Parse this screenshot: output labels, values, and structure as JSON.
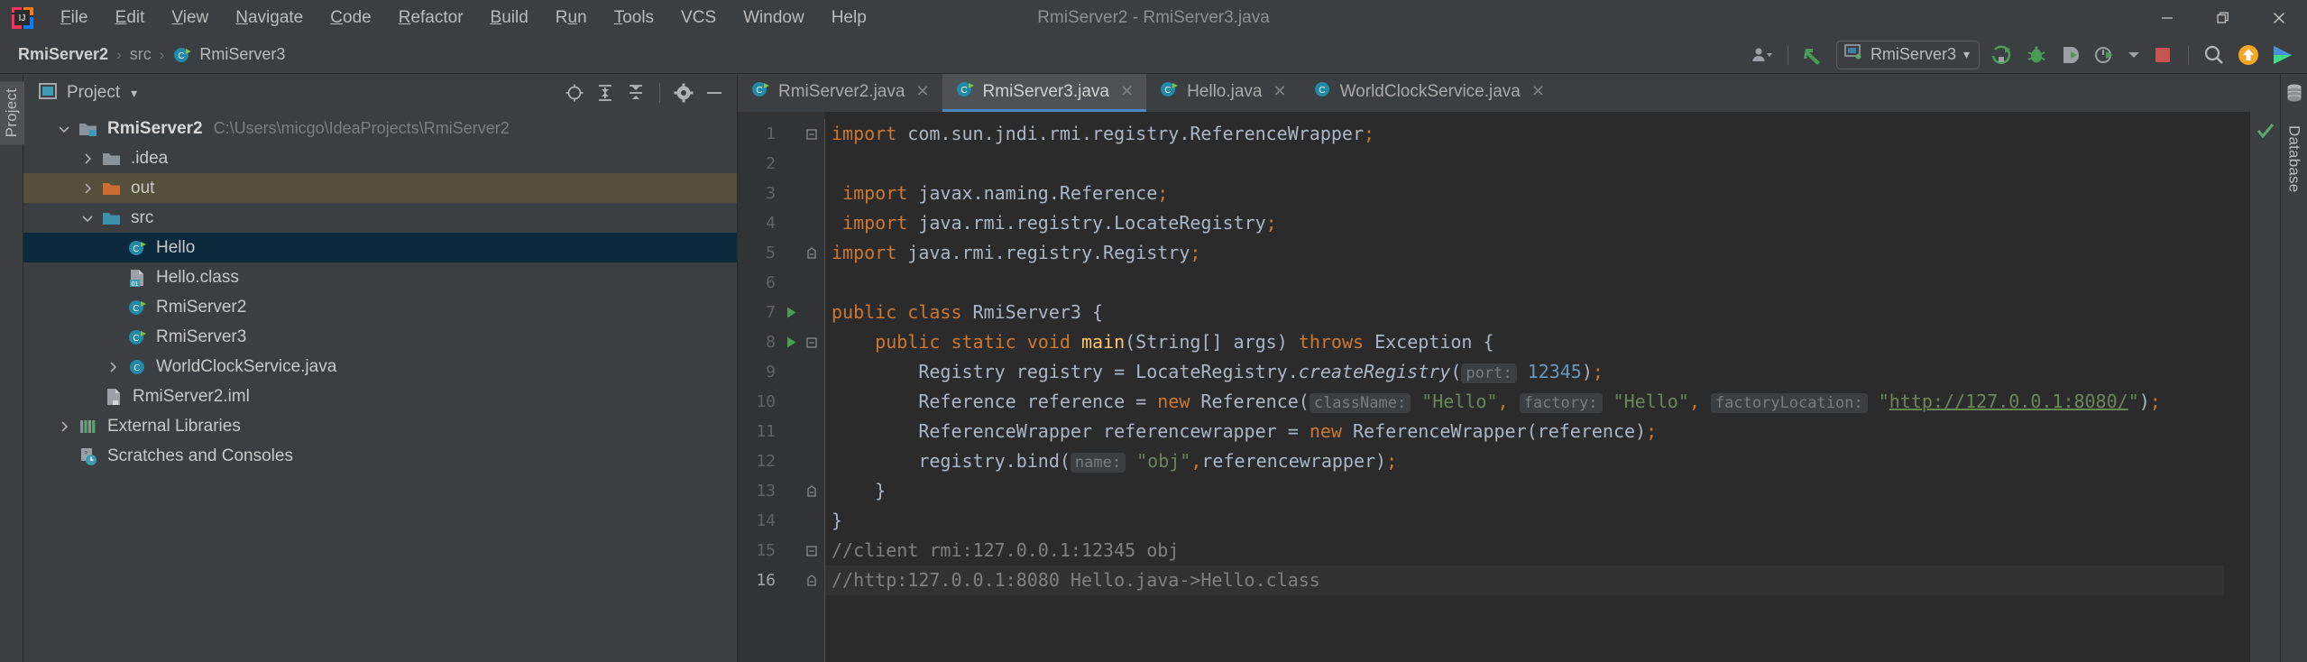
{
  "window": {
    "title": "RmiServer2 - RmiServer3.java",
    "app_icon": "intellij-idea-logo",
    "controls": {
      "minimize": "–",
      "maximize": "restore-icon",
      "close": "✕"
    }
  },
  "menubar": {
    "items": [
      {
        "label": "File",
        "mnemonic": "F"
      },
      {
        "label": "Edit",
        "mnemonic": "E"
      },
      {
        "label": "View",
        "mnemonic": "V"
      },
      {
        "label": "Navigate",
        "mnemonic": "N"
      },
      {
        "label": "Code",
        "mnemonic": "C"
      },
      {
        "label": "Refactor",
        "mnemonic": "R"
      },
      {
        "label": "Build",
        "mnemonic": "B"
      },
      {
        "label": "Run",
        "mnemonic": "u"
      },
      {
        "label": "Tools",
        "mnemonic": "T"
      },
      {
        "label": "VCS",
        "mnemonic": ""
      },
      {
        "label": "Window",
        "mnemonic": ""
      },
      {
        "label": "Help",
        "mnemonic": ""
      }
    ]
  },
  "navbar": {
    "breadcrumbs": [
      {
        "label": "RmiServer2",
        "icon": "",
        "bold": true
      },
      {
        "label": "src",
        "icon": "",
        "bold": false
      },
      {
        "label": "RmiServer3",
        "icon": "java-class-icon",
        "bold": false
      }
    ],
    "separator": "›",
    "toolbar": {
      "user_icon": "user-silhouette-icon",
      "user_caret": "▾",
      "vcs_update_icon": "vcs-update-arrow-icon",
      "run_config_icon": "application-config-icon",
      "run_config_label": "RmiServer3",
      "run_config_caret": "▾",
      "run_icon": "run-icon",
      "debug_icon": "debug-bug-icon",
      "run_coverage_icon": "run-with-coverage-icon",
      "profiler_icon": "profiler-icon",
      "profiler_caret": "▾",
      "stop_icon": "stop-square-icon",
      "search_icon": "search-everywhere-icon",
      "update_icon": "update-available-icon",
      "ide_icon": "ide-features-icon"
    }
  },
  "left_stripe": {
    "tabs": [
      {
        "label": "Project",
        "active": true
      }
    ]
  },
  "right_stripe": {
    "tabs": [
      {
        "label": "Database",
        "icon": "database-icon",
        "active": false
      }
    ]
  },
  "project_panel": {
    "icon": "project-view-icon",
    "title": "Project",
    "caret": "▾",
    "actions": [
      {
        "name": "select-opened-file-icon",
        "glyph": "target"
      },
      {
        "name": "expand-all-icon",
        "glyph": "expand"
      },
      {
        "name": "collapse-all-icon",
        "glyph": "collapse"
      },
      {
        "name": "settings-gear-icon",
        "glyph": "gear"
      },
      {
        "name": "hide-panel-icon",
        "glyph": "minus"
      }
    ],
    "tree": [
      {
        "label": "RmiServer2",
        "path": "C:\\Users\\micgo\\IdeaProjects\\RmiServer2",
        "indent": 0,
        "twisty": "down",
        "icon": "project-folder-icon",
        "bold": true,
        "state": "none"
      },
      {
        "label": ".idea",
        "path": "",
        "indent": 1,
        "twisty": "right",
        "icon": "folder-grey-icon",
        "bold": false,
        "state": "none"
      },
      {
        "label": "out",
        "path": "",
        "indent": 1,
        "twisty": "right",
        "icon": "folder-orange-icon",
        "bold": false,
        "state": "olive"
      },
      {
        "label": "src",
        "path": "",
        "indent": 1,
        "twisty": "down",
        "icon": "folder-source-icon",
        "bold": false,
        "state": "none"
      },
      {
        "label": "Hello",
        "path": "",
        "indent": 2,
        "twisty": "none",
        "icon": "java-class-runnable-icon",
        "bold": false,
        "state": "blue"
      },
      {
        "label": "Hello.class",
        "path": "",
        "indent": 2,
        "twisty": "none",
        "icon": "class-file-icon",
        "bold": false,
        "state": "none"
      },
      {
        "label": "RmiServer2",
        "path": "",
        "indent": 2,
        "twisty": "none",
        "icon": "java-class-runnable-icon",
        "bold": false,
        "state": "none"
      },
      {
        "label": "RmiServer3",
        "path": "",
        "indent": 2,
        "twisty": "none",
        "icon": "java-class-runnable-icon",
        "bold": false,
        "state": "none"
      },
      {
        "label": "WorldClockService.java",
        "path": "",
        "indent": 2,
        "twisty": "right",
        "icon": "java-class-icon",
        "bold": false,
        "state": "none"
      },
      {
        "label": "RmiServer2.iml",
        "path": "",
        "indent": 1,
        "twisty": "none",
        "icon": "iml-file-icon",
        "bold": false,
        "state": "none"
      },
      {
        "label": "External Libraries",
        "path": "",
        "indent": 0,
        "twisty": "right",
        "icon": "libraries-icon",
        "bold": false,
        "state": "none"
      },
      {
        "label": "Scratches and Consoles",
        "path": "",
        "indent": 0,
        "twisty": "none",
        "icon": "scratches-icon",
        "bold": false,
        "state": "none"
      }
    ]
  },
  "editor": {
    "tabs": [
      {
        "label": "RmiServer2.java",
        "icon": "java-class-runnable-icon",
        "close": "✕",
        "active": false
      },
      {
        "label": "RmiServer3.java",
        "icon": "java-class-runnable-icon",
        "close": "✕",
        "active": true
      },
      {
        "label": "Hello.java",
        "icon": "java-class-runnable-icon",
        "close": "✕",
        "active": false
      },
      {
        "label": "WorldClockService.java",
        "icon": "java-class-icon",
        "close": "✕",
        "active": false
      }
    ],
    "inspection_status": "ok-checkmark",
    "current_line": 16,
    "lines": [
      {
        "n": "1",
        "fold": "minus",
        "run": false,
        "text": "import com.sun.jndi.rmi.registry.ReferenceWrapper;"
      },
      {
        "n": "2",
        "fold": "",
        "run": false,
        "text": ""
      },
      {
        "n": "3",
        "fold": "",
        "run": false,
        "text": "import javax.naming.Reference;"
      },
      {
        "n": "4",
        "fold": "",
        "run": false,
        "text": "import java.rmi.registry.LocateRegistry;"
      },
      {
        "n": "5",
        "fold": "end",
        "run": false,
        "text": "import java.rmi.registry.Registry;"
      },
      {
        "n": "6",
        "fold": "",
        "run": false,
        "text": ""
      },
      {
        "n": "7",
        "fold": "",
        "run": true,
        "text": "public class RmiServer3 {"
      },
      {
        "n": "8",
        "fold": "minus",
        "run": true,
        "text": "    public static void main(String[] args) throws Exception {"
      },
      {
        "n": "9",
        "fold": "",
        "run": false,
        "text": "        Registry registry = LocateRegistry.createRegistry( port: 12345);"
      },
      {
        "n": "10",
        "fold": "",
        "run": false,
        "text": "        Reference reference = new Reference( className: \"Hello\", factory: \"Hello\", factoryLocation: \"http://127.0.0.1:8080/\");"
      },
      {
        "n": "11",
        "fold": "",
        "run": false,
        "text": "        ReferenceWrapper referencewrapper = new ReferenceWrapper(reference);"
      },
      {
        "n": "12",
        "fold": "",
        "run": false,
        "text": "        registry.bind( name: \"obj\",referencewrapper);"
      },
      {
        "n": "13",
        "fold": "end",
        "run": false,
        "text": "    }"
      },
      {
        "n": "14",
        "fold": "",
        "run": false,
        "text": "}"
      },
      {
        "n": "15",
        "fold": "minus",
        "run": false,
        "text": "//client rmi:127.0.0.1:12345 obj"
      },
      {
        "n": "16",
        "fold": "end",
        "run": false,
        "text": "//http:127.0.0.1:8080 Hello.java->Hello.class"
      }
    ]
  },
  "colors": {
    "chrome_bg": "#3c3f41",
    "editor_bg": "#2b2b2b",
    "gutter_bg": "#313335",
    "selection_blue": "#0d293e",
    "selection_olive": "#55503c",
    "accent_green": "#499c54",
    "keyword_orange": "#cc7832",
    "string_green": "#6a8759",
    "number_blue": "#6897bb",
    "comment_grey": "#808080",
    "text_grey": "#bbbbbb"
  }
}
